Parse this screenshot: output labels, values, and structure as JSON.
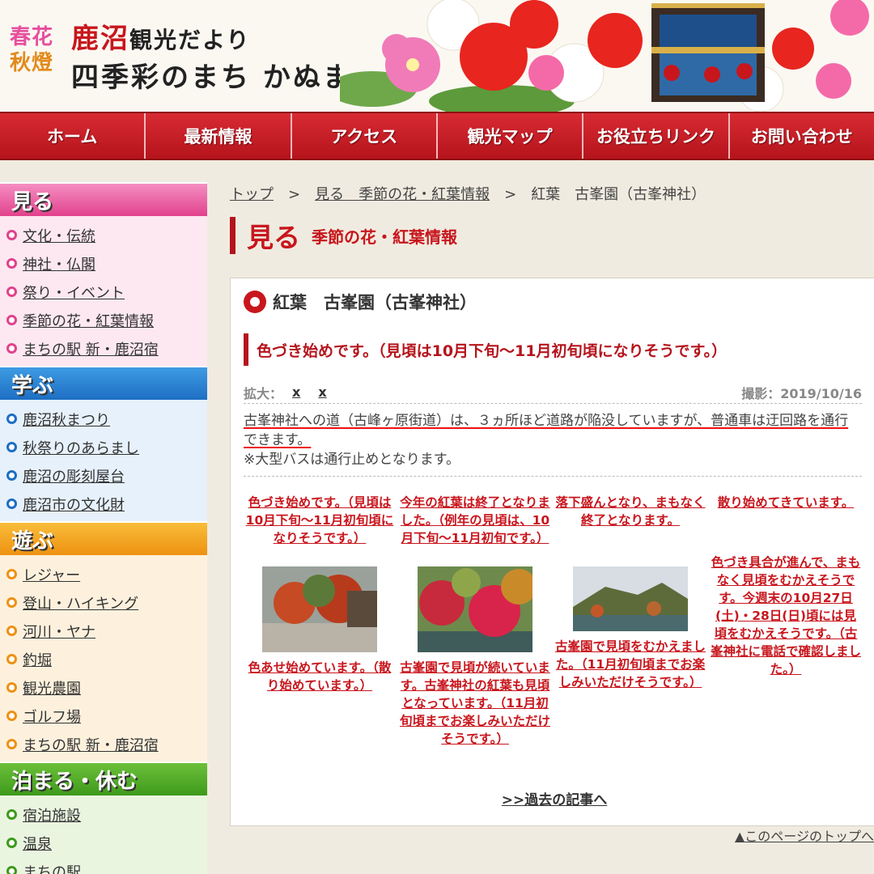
{
  "header": {
    "badge_line1": "春花",
    "badge_line2": "秋燈",
    "title_main": "鹿沼",
    "title_small": "観光だより",
    "tagline": "四季彩のまち かぬま"
  },
  "nav": {
    "items": [
      "ホーム",
      "最新情報",
      "アクセス",
      "観光マップ",
      "お役立ちリンク",
      "お問い合わせ"
    ]
  },
  "sidebar": {
    "sections": [
      {
        "title": "見る",
        "items": [
          "文化・伝統",
          "神社・仏閣",
          "祭り・イベント",
          "季節の花・紅葉情報",
          "まちの駅 新・鹿沼宿"
        ]
      },
      {
        "title": "学ぶ",
        "items": [
          "鹿沼秋まつり",
          "秋祭りのあらまし",
          "鹿沼の彫刻屋台",
          "鹿沼市の文化財"
        ]
      },
      {
        "title": "遊ぶ",
        "items": [
          "レジャー",
          "登山・ハイキング",
          "河川・ヤナ",
          "釣堀",
          "観光農園",
          "ゴルフ場",
          "まちの駅 新・鹿沼宿"
        ]
      },
      {
        "title": "泊まる・休む",
        "items": [
          "宿泊施設",
          "温泉",
          "まちの駅"
        ]
      }
    ]
  },
  "breadcrumb": {
    "items": [
      "トップ",
      "見る　季節の花・紅葉情報",
      "紅葉　古峯園（古峯神社）"
    ],
    "separator": ">"
  },
  "page_title": {
    "main": "見る",
    "sub": "季節の花・紅葉情報"
  },
  "article": {
    "title": "紅葉　古峯園（古峯神社）",
    "status": "色づき始めです。（見頃は10月下旬～11月初旬頃になりそうです。）",
    "zoom_label": "拡大：",
    "zoom_links": [
      "x",
      "x"
    ],
    "date": "撮影：2019/10/16",
    "road_note": "古峯神社への道（古峰ヶ原街道）は、３ヵ所ほど道路が陥没していますが、普通車は迂回路を通行できます。",
    "bus_note": "※大型バスは通行止めとなります。",
    "entries_row1": [
      "色づき始めです。（見頃は10月下旬～11月初旬頃になりそうです。）",
      "今年の紅葉は終了となりました。（例年の見頃は、10月下旬～11月初旬です。）",
      "落下盛んとなり、まもなく終了となります。",
      "散り始めてきています。"
    ],
    "entries_row2": [
      "色あせ始めています。（散り始めています。）",
      "古峯園で見頃が続いています。古峯神社の紅葉も見頃となっています。（11月初旬頃までお楽しみいただけそうです。）",
      "古峯園で見頃をむかえました。（11月初旬頃までお楽しみいただけそうです。）",
      "色づき具合が進んで、まもなく見頃をむかえそうです。今週末の10月27日(土)・28日(日)頃には見頃をむかえそうです。（古峯神社に電話で確認しました。）"
    ],
    "past_link": ">>過去の記事へ"
  },
  "footer": {
    "page_top": "▲このページのトップへ"
  },
  "colors": {
    "brand_red": "#c8161d",
    "miru_pink": "#e1418c",
    "manabu_blue": "#1d6ec3",
    "asobu_orange": "#ee9112",
    "tomaru_green": "#3e9a1b"
  }
}
